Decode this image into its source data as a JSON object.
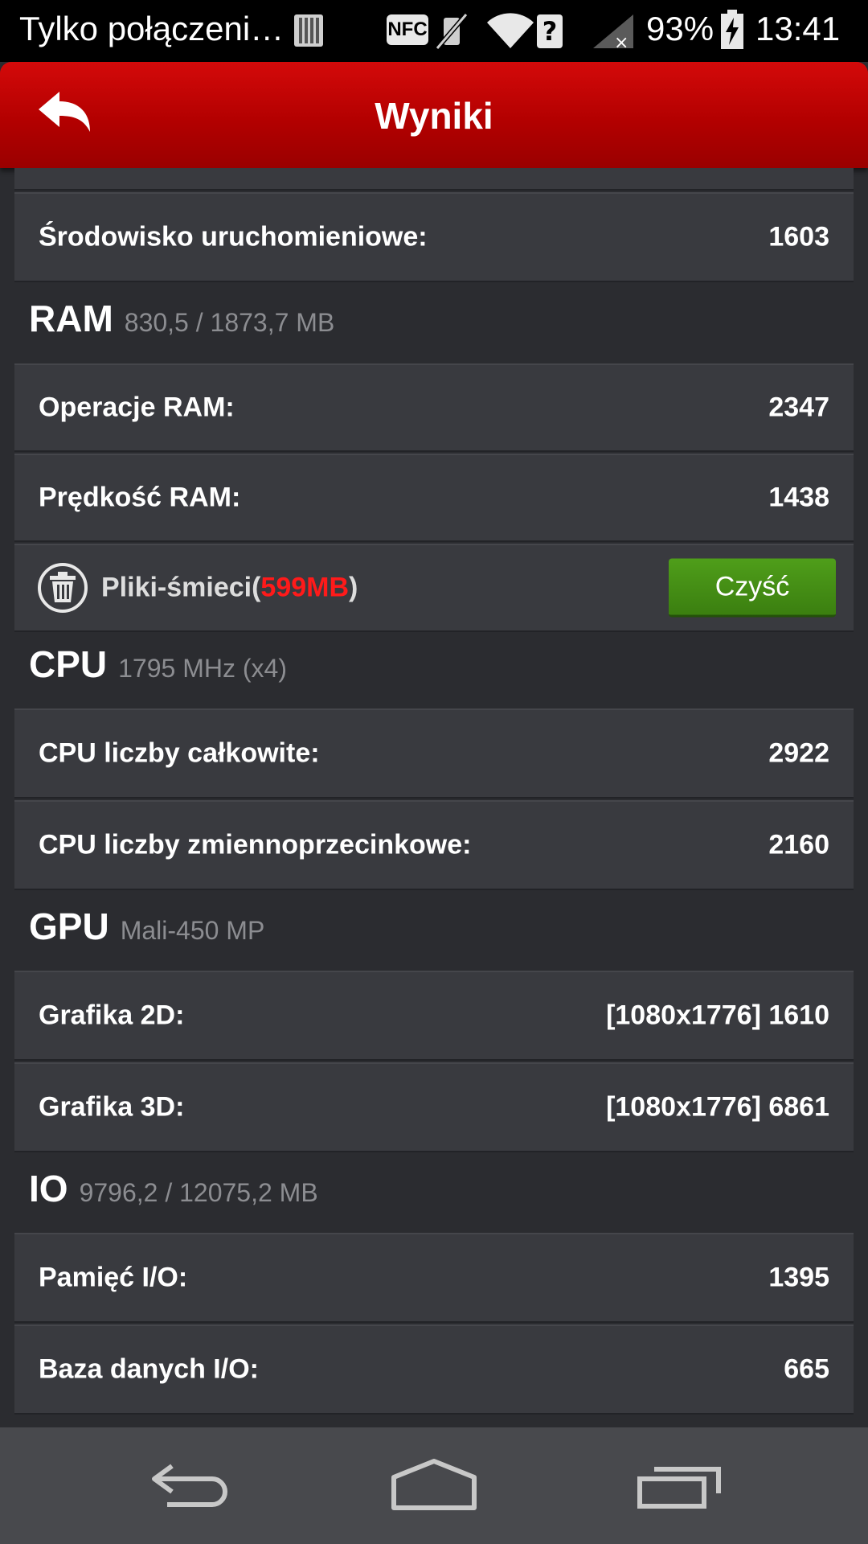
{
  "status_bar": {
    "carrier": "Tylko połączeni…",
    "nfc": "NFC",
    "unknown_badge": "?",
    "battery_percent": "93%",
    "time": "13:41",
    "icons": [
      "sim-card-icon",
      "nfc-icon",
      "vibrate-mute-icon",
      "wifi-icon",
      "question-icon",
      "signal-no-service-icon",
      "battery-charging-icon"
    ]
  },
  "action_bar": {
    "title": "Wyniki",
    "back_icon": "back-arrow-icon"
  },
  "top_partial": {
    "label": "Środowisko uruchomieniowe:",
    "value": "1603"
  },
  "sections": {
    "ram": {
      "title": "RAM",
      "subtitle": "830,5 / 1873,7 MB",
      "rows": [
        {
          "label": "Operacje RAM:",
          "value": "2347"
        },
        {
          "label": "Prędkość RAM:",
          "value": "1438"
        }
      ],
      "junk": {
        "label_prefix": "Pliki-śmieci(",
        "size": "599MB",
        "label_suffix": ")",
        "button": "Czyść",
        "icon": "trash-icon"
      }
    },
    "cpu": {
      "title": "CPU",
      "subtitle": "1795 MHz (x4)",
      "rows": [
        {
          "label": "CPU liczby całkowite:",
          "value": "2922"
        },
        {
          "label": "CPU liczby zmiennoprzecinkowe:",
          "value": "2160"
        }
      ]
    },
    "gpu": {
      "title": "GPU",
      "subtitle": "Mali-450 MP",
      "rows": [
        {
          "label": "Grafika 2D:",
          "value": "[1080x1776] 1610"
        },
        {
          "label": "Grafika 3D:",
          "value": "[1080x1776] 6861"
        }
      ]
    },
    "io": {
      "title": "IO",
      "subtitle": "9796,2 / 12075,2 MB",
      "rows": [
        {
          "label": "Pamięć I/O:",
          "value": "1395"
        },
        {
          "label": "Baza danych I/O:",
          "value": "665"
        }
      ]
    }
  },
  "nav_bar": {
    "icons": [
      "nav-back-icon",
      "nav-home-icon",
      "nav-recents-icon"
    ]
  },
  "colors": {
    "action_bar": "#c00000",
    "junk_size": "#ff1a1a",
    "clean_button": "#4a9618",
    "background": "#2b2c30",
    "card": "#393a3f"
  }
}
